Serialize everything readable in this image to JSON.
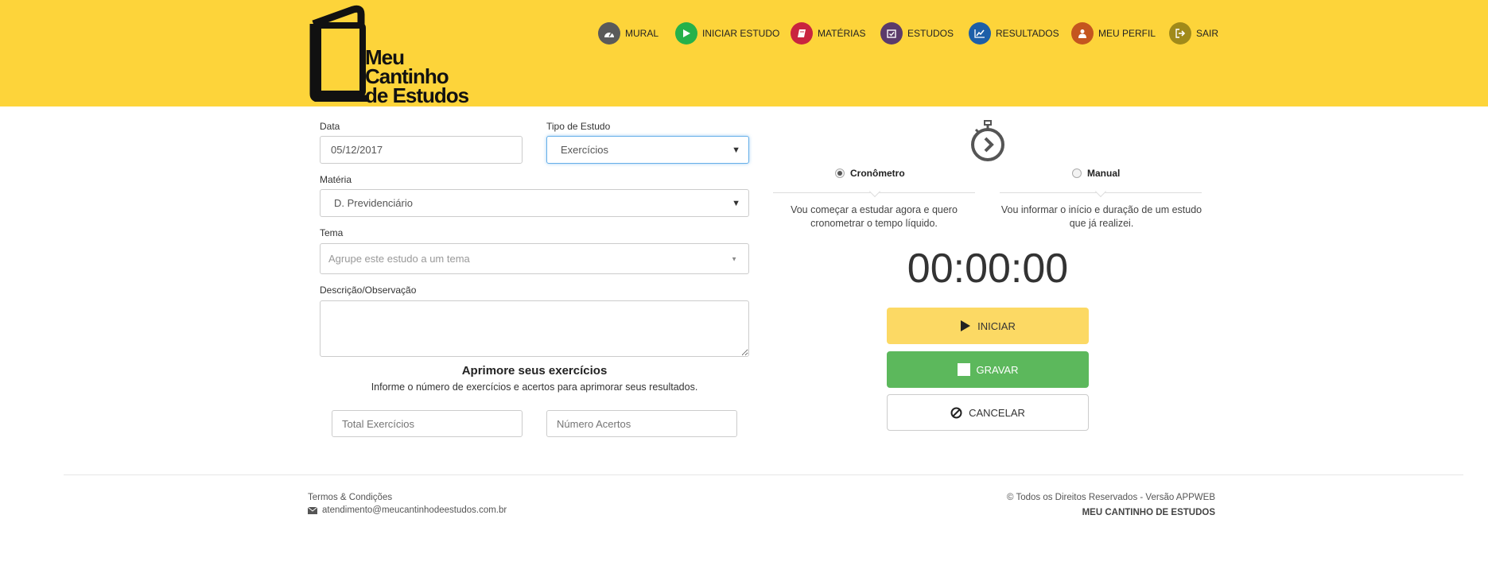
{
  "header": {
    "logo_text": [
      "Meu",
      "Cantinho",
      "de Estudos"
    ],
    "nav": [
      {
        "label": "MURAL",
        "icon": "dashboard-icon",
        "color": "#5a5a5a"
      },
      {
        "label": "INICIAR ESTUDO",
        "icon": "play-icon",
        "color": "#26b14a"
      },
      {
        "label": "MATÉRIAS",
        "icon": "book-icon",
        "color": "#c9243f"
      },
      {
        "label": "ESTUDOS",
        "icon": "calendar-check-icon",
        "color": "#5b3b6b"
      },
      {
        "label": "RESULTADOS",
        "icon": "chart-line-icon",
        "color": "#1d5fa8"
      },
      {
        "label": "MEU PERFIL",
        "icon": "user-icon",
        "color": "#c4561f"
      },
      {
        "label": "SAIR",
        "icon": "logout-icon",
        "color": "#a08a1a"
      }
    ]
  },
  "form": {
    "data_label": "Data",
    "data_value": "05/12/2017",
    "tipo_label": "Tipo de Estudo",
    "tipo_value": "Exercícios",
    "materia_label": "Matéria",
    "materia_value": "D. Previdenciário",
    "tema_label": "Tema",
    "tema_placeholder": "Agrupe este estudo a um tema",
    "descricao_label": "Descrição/Observação",
    "descricao_value": "",
    "improve_title": "Aprimore seus exercícios",
    "improve_subtitle": "Informe o número de exercícios e acertos para aprimorar seus resultados.",
    "total_placeholder": "Total Exercícios",
    "acertos_placeholder": "Número Acertos"
  },
  "timer_panel": {
    "mode_cronometro": "Cronômetro",
    "mode_manual": "Manual",
    "cronometro_desc_1": "Vou começar a estudar agora e quero",
    "cronometro_desc_2": "cronometrar o tempo líquido.",
    "manual_desc_1": "Vou informar o início e duração de um estudo",
    "manual_desc_2": "que já realizei.",
    "time": "00:00:00",
    "start_label": "INICIAR",
    "save_label": "GRAVAR",
    "cancel_label": "CANCELAR",
    "colors": {
      "start": "#fcd964",
      "save": "#5cb85c"
    }
  },
  "footer": {
    "terms": "Termos & Condições",
    "email": "atendimento@meucantinhodeestudos.com.br",
    "rights": "© Todos os Direitos Reservados - Versão APPWEB",
    "brand": "MEU CANTINHO DE ESTUDOS"
  }
}
